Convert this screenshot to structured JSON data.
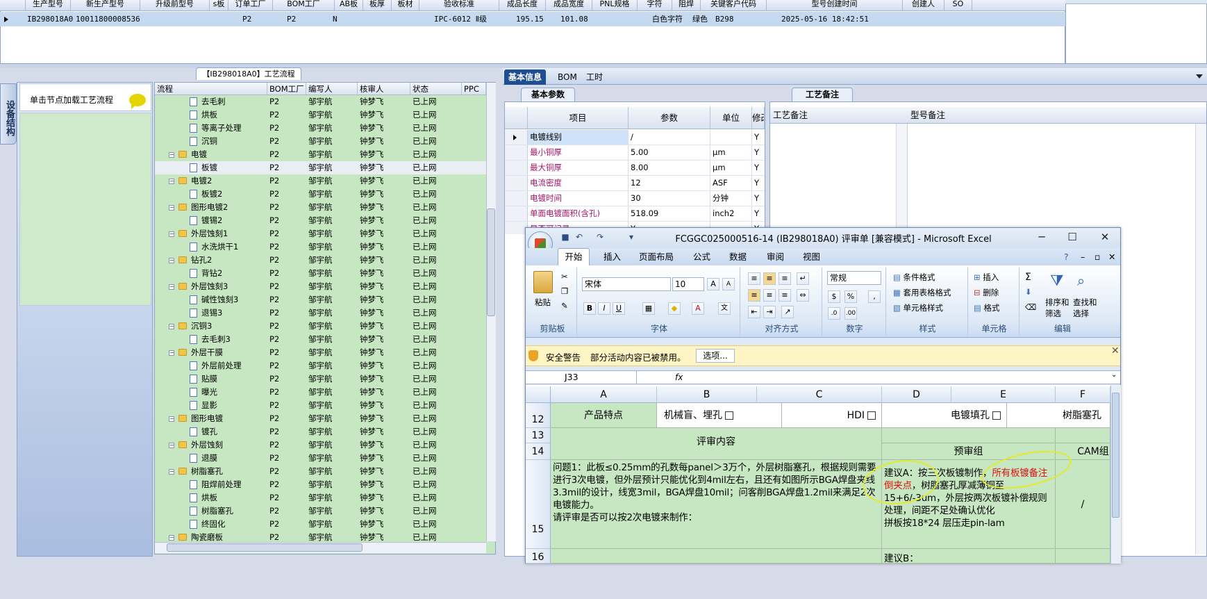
{
  "top_grid": {
    "headers": [
      "生产型号",
      "新生产型号",
      "升级前型号",
      "s板",
      "订单工厂",
      "BOM工厂",
      "AB板",
      "板厚",
      "板材",
      "验收标准",
      "成品长度",
      "成品宽度",
      "PNL规格",
      "字符",
      "阻焊",
      "关键客户代码",
      "型号创建时间",
      "创建人",
      "SO"
    ],
    "row": [
      "IB298018A0",
      "10011800008536",
      "",
      "",
      "P2",
      "P2",
      "N",
      "",
      "",
      "IPC-6012 Ⅱ级",
      "195.15",
      "101.08",
      "",
      "白色字符",
      "绿色",
      "B298",
      "2025-05-16 18:42:51",
      "",
      ""
    ]
  },
  "left_panel": {
    "vertical_tab": "设备结构",
    "hint": "单击节点加载工艺流程"
  },
  "process_tree": {
    "title": "【IB298018A0】工艺流程",
    "columns": [
      "流程",
      "BOM工厂",
      "编写人",
      "核审人",
      "状态",
      "PPC"
    ],
    "rows": [
      {
        "name": "去毛刺",
        "level": 2,
        "type": "doc",
        "bom": "P2",
        "writer": "邹宇航",
        "reviewer": "钟梦飞",
        "status": "已上网"
      },
      {
        "name": "烘板",
        "level": 2,
        "type": "doc",
        "bom": "P2",
        "writer": "邹宇航",
        "reviewer": "钟梦飞",
        "status": "已上网"
      },
      {
        "name": "等离子处理",
        "level": 2,
        "type": "doc",
        "bom": "P2",
        "writer": "邹宇航",
        "reviewer": "钟梦飞",
        "status": "已上网"
      },
      {
        "name": "沉铜",
        "level": 2,
        "type": "doc",
        "bom": "P2",
        "writer": "邹宇航",
        "reviewer": "钟梦飞",
        "status": "已上网"
      },
      {
        "name": "电镀",
        "level": 1,
        "type": "folder",
        "bom": "P2",
        "writer": "邹宇航",
        "reviewer": "钟梦飞",
        "status": "已上网"
      },
      {
        "name": "板镀",
        "level": 2,
        "type": "doc",
        "bom": "P2",
        "writer": "邹宇航",
        "reviewer": "钟梦飞",
        "status": "已上网",
        "selected": true
      },
      {
        "name": "电镀2",
        "level": 1,
        "type": "folder",
        "bom": "P2",
        "writer": "邹宇航",
        "reviewer": "钟梦飞",
        "status": "已上网"
      },
      {
        "name": "板镀2",
        "level": 2,
        "type": "doc",
        "bom": "P2",
        "writer": "邹宇航",
        "reviewer": "钟梦飞",
        "status": "已上网"
      },
      {
        "name": "图形电镀2",
        "level": 1,
        "type": "folder",
        "bom": "P2",
        "writer": "邹宇航",
        "reviewer": "钟梦飞",
        "status": "已上网"
      },
      {
        "name": "镀锡2",
        "level": 2,
        "type": "doc",
        "bom": "P2",
        "writer": "邹宇航",
        "reviewer": "钟梦飞",
        "status": "已上网"
      },
      {
        "name": "外层蚀刻1",
        "level": 1,
        "type": "folder",
        "bom": "P2",
        "writer": "邹宇航",
        "reviewer": "钟梦飞",
        "status": "已上网"
      },
      {
        "name": "水洗烘干1",
        "level": 2,
        "type": "doc",
        "bom": "P2",
        "writer": "邹宇航",
        "reviewer": "钟梦飞",
        "status": "已上网"
      },
      {
        "name": "钻孔2",
        "level": 1,
        "type": "folder",
        "bom": "P2",
        "writer": "邹宇航",
        "reviewer": "钟梦飞",
        "status": "已上网"
      },
      {
        "name": "背钻2",
        "level": 2,
        "type": "doc",
        "bom": "P2",
        "writer": "邹宇航",
        "reviewer": "钟梦飞",
        "status": "已上网"
      },
      {
        "name": "外层蚀刻3",
        "level": 1,
        "type": "folder",
        "bom": "P2",
        "writer": "邹宇航",
        "reviewer": "钟梦飞",
        "status": "已上网"
      },
      {
        "name": "碱性蚀刻3",
        "level": 2,
        "type": "doc",
        "bom": "P2",
        "writer": "邹宇航",
        "reviewer": "钟梦飞",
        "status": "已上网"
      },
      {
        "name": "退锡3",
        "level": 2,
        "type": "doc",
        "bom": "P2",
        "writer": "邹宇航",
        "reviewer": "钟梦飞",
        "status": "已上网"
      },
      {
        "name": "沉铜3",
        "level": 1,
        "type": "folder",
        "bom": "P2",
        "writer": "邹宇航",
        "reviewer": "钟梦飞",
        "status": "已上网"
      },
      {
        "name": "去毛刺3",
        "level": 2,
        "type": "doc",
        "bom": "P2",
        "writer": "邹宇航",
        "reviewer": "钟梦飞",
        "status": "已上网"
      },
      {
        "name": "外层干膜",
        "level": 1,
        "type": "folder",
        "bom": "P2",
        "writer": "邹宇航",
        "reviewer": "钟梦飞",
        "status": "已上网"
      },
      {
        "name": "外层前处理",
        "level": 2,
        "type": "doc",
        "bom": "P2",
        "writer": "邹宇航",
        "reviewer": "钟梦飞",
        "status": "已上网"
      },
      {
        "name": "贴膜",
        "level": 2,
        "type": "doc",
        "bom": "P2",
        "writer": "邹宇航",
        "reviewer": "钟梦飞",
        "status": "已上网"
      },
      {
        "name": "曝光",
        "level": 2,
        "type": "doc",
        "bom": "P2",
        "writer": "邹宇航",
        "reviewer": "钟梦飞",
        "status": "已上网"
      },
      {
        "name": "显影",
        "level": 2,
        "type": "doc",
        "bom": "P2",
        "writer": "邹宇航",
        "reviewer": "钟梦飞",
        "status": "已上网"
      },
      {
        "name": "图形电镀",
        "level": 1,
        "type": "folder",
        "bom": "P2",
        "writer": "邹宇航",
        "reviewer": "钟梦飞",
        "status": "已上网"
      },
      {
        "name": "镀孔",
        "level": 2,
        "type": "doc",
        "bom": "P2",
        "writer": "邹宇航",
        "reviewer": "钟梦飞",
        "status": "已上网"
      },
      {
        "name": "外层蚀刻",
        "level": 1,
        "type": "folder",
        "bom": "P2",
        "writer": "邹宇航",
        "reviewer": "钟梦飞",
        "status": "已上网"
      },
      {
        "name": "退膜",
        "level": 2,
        "type": "doc",
        "bom": "P2",
        "writer": "邹宇航",
        "reviewer": "钟梦飞",
        "status": "已上网"
      },
      {
        "name": "树脂塞孔",
        "level": 1,
        "type": "folder",
        "bom": "P2",
        "writer": "邹宇航",
        "reviewer": "钟梦飞",
        "status": "已上网"
      },
      {
        "name": "阻焊前处理",
        "level": 2,
        "type": "doc",
        "bom": "P2",
        "writer": "邹宇航",
        "reviewer": "钟梦飞",
        "status": "已上网"
      },
      {
        "name": "烘板",
        "level": 2,
        "type": "doc",
        "bom": "P2",
        "writer": "邹宇航",
        "reviewer": "钟梦飞",
        "status": "已上网"
      },
      {
        "name": "树脂塞孔",
        "level": 2,
        "type": "doc",
        "bom": "P2",
        "writer": "邹宇航",
        "reviewer": "钟梦飞",
        "status": "已上网"
      },
      {
        "name": "终固化",
        "level": 2,
        "type": "doc",
        "bom": "P2",
        "writer": "邹宇航",
        "reviewer": "钟梦飞",
        "status": "已上网"
      },
      {
        "name": "陶瓷磨板",
        "level": 1,
        "type": "folder",
        "bom": "P2",
        "writer": "邹宇航",
        "reviewer": "钟梦飞",
        "status": "已上网"
      }
    ]
  },
  "right_tabs": [
    "基本信息",
    "BOM",
    "工时"
  ],
  "basic_params": {
    "tab": "基本参数",
    "columns": [
      "项目",
      "参数",
      "单位",
      "修改"
    ],
    "rows": [
      {
        "item": "电镀线别",
        "value": "/",
        "unit": "",
        "mod": "Y"
      },
      {
        "item": "最小铜厚",
        "value": "5.00",
        "unit": "μm",
        "mod": "Y"
      },
      {
        "item": "最大铜厚",
        "value": "8.00",
        "unit": "μm",
        "mod": "Y"
      },
      {
        "item": "电流密度",
        "value": "12",
        "unit": "ASF",
        "mod": "Y"
      },
      {
        "item": "电镀时间",
        "value": "30",
        "unit": "分钟",
        "mod": "Y"
      },
      {
        "item": "单面电镀面积(含孔)",
        "value": "518.09",
        "unit": "inch2",
        "mod": "Y"
      },
      {
        "item": "是否可记录",
        "value": "Y",
        "unit": "",
        "mod": "Y"
      }
    ]
  },
  "process_notes": {
    "tab": "工艺备注",
    "col1": "工艺备注",
    "col2": "型号备注"
  },
  "excel": {
    "title": "FCGGC025000516-14 (IB298018A0) 评审单 [兼容模式] - Microsoft Excel",
    "tabs": [
      "开始",
      "插入",
      "页面布局",
      "公式",
      "数据",
      "审阅",
      "视图"
    ],
    "clipboard": {
      "paste": "粘贴",
      "label": "剪贴板"
    },
    "font": {
      "name": "宋体",
      "size": "10",
      "label": "字体"
    },
    "alignment_label": "对齐方式",
    "number": {
      "format": "常规",
      "label": "数字"
    },
    "styles": {
      "items": [
        "条件格式",
        "套用表格格式",
        "单元格样式"
      ],
      "label": "样式"
    },
    "cells": {
      "items": [
        "插入",
        "删除",
        "格式"
      ],
      "label": "单元格"
    },
    "editing": {
      "sort": "排序和筛选",
      "find": "查找和选择",
      "label": "编辑"
    },
    "security": {
      "title": "安全警告",
      "message": "部分活动内容已被禁用。",
      "button": "选项..."
    },
    "name_box": "J33",
    "fx": "fx",
    "columns": [
      "A",
      "B",
      "C",
      "D",
      "E",
      "F"
    ],
    "rows": [
      "12",
      "13",
      "14",
      "15",
      "16"
    ],
    "cells_text": {
      "a12": "产品特点",
      "b12": "机械盲、埋孔",
      "c12": "HDI",
      "d12": "电镀填孔",
      "f12": "树脂塞孔",
      "a13": "评审内容",
      "de14": "预审组",
      "f14": "CAM组",
      "a15": "问题1：此板≤0.25mm的孔数每panel＞3万个，外层树脂塞孔，根据规则需要进行3次电镀，但外层预计只能优化到4mil左右，且还有如图所示BGA焊盘夹线3.3mil的设计，线宽3mil，BGA焊盘10mil；问客削BGA焊盘1.2mil来满足2次电镀能力。\n请评审是否可以按2次电镀来制作：",
      "de15_a": "建议A：按三次板镀制作，",
      "de15_red": "所有板镀备注倒夹点",
      "de15_b": "，树脂塞孔厚减薄铜至15+6/-3um，外层按两次板镀补偿规则处理，间距不足处确认优化\n拼板按18*24 层压走pin-lam",
      "f15": "/",
      "de16": "建议B："
    }
  }
}
